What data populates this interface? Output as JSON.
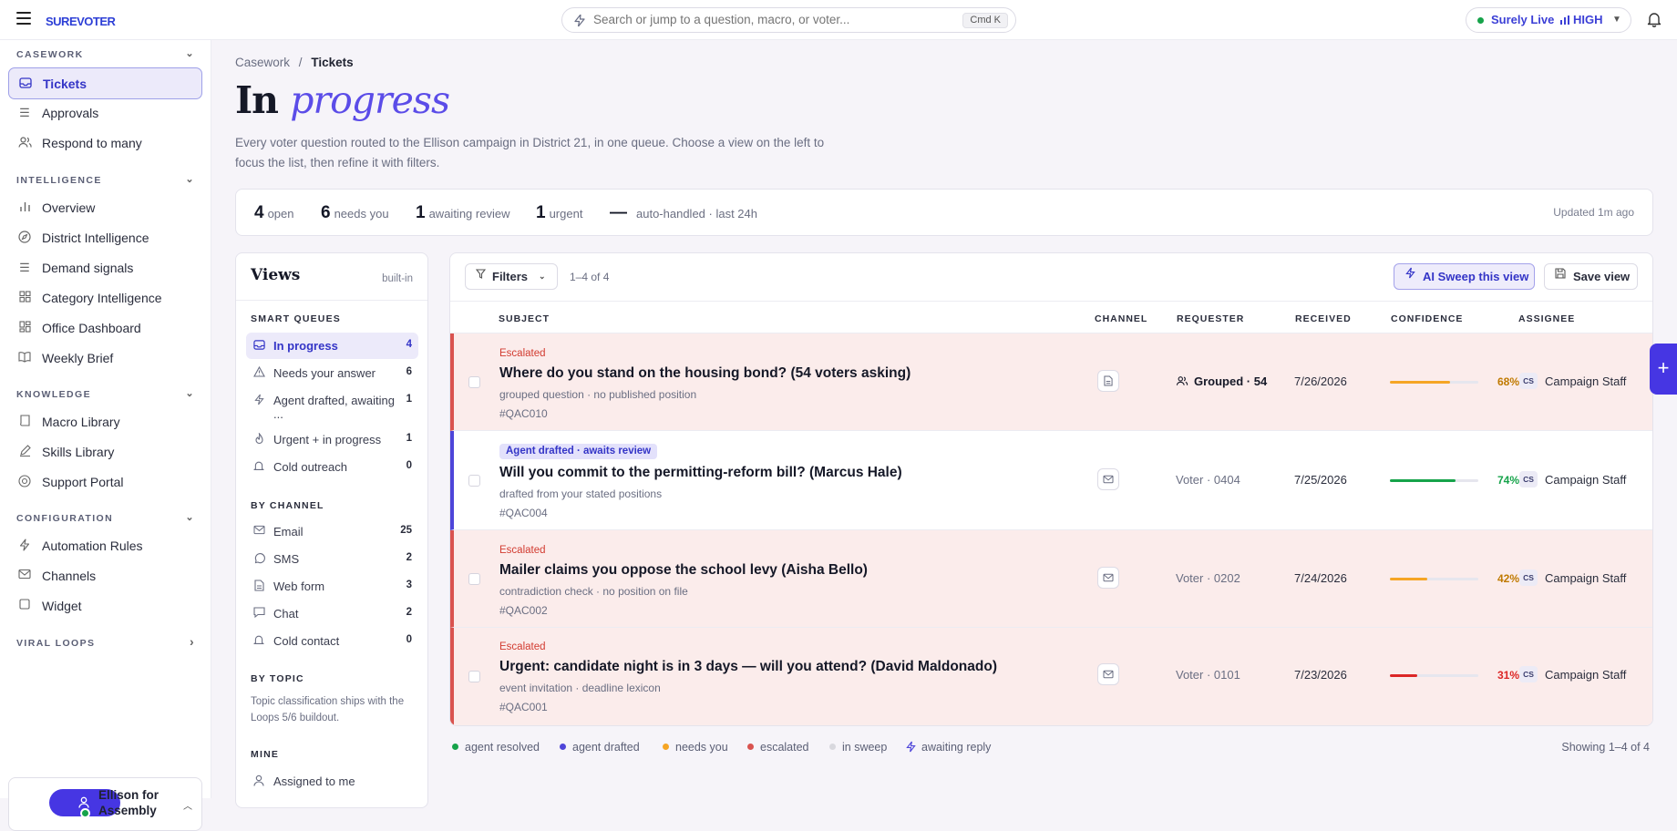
{
  "app": {
    "logo": "SUREVOTER",
    "search_placeholder": "Search or jump to a question, macro, or voter...",
    "search_shortcut": "Cmd K",
    "live_label": "Surely Live",
    "live_level": "HIGH"
  },
  "sidebar": {
    "sections": [
      {
        "title": "CASEWORK",
        "items": [
          "Tickets",
          "Approvals",
          "Respond to many"
        ]
      },
      {
        "title": "INTELLIGENCE",
        "items": [
          "Overview",
          "District Intelligence",
          "Demand signals",
          "Category Intelligence",
          "Office Dashboard",
          "Weekly Brief"
        ]
      },
      {
        "title": "KNOWLEDGE",
        "items": [
          "Macro Library",
          "Skills Library",
          "Support Portal"
        ]
      },
      {
        "title": "CONFIGURATION",
        "items": [
          "Automation Rules",
          "Channels",
          "Widget"
        ]
      },
      {
        "title": "VIRAL LOOPS",
        "items": []
      }
    ],
    "org_name": "Ellison for Assembly"
  },
  "breadcrumb": {
    "parent": "Casework",
    "current": "Tickets"
  },
  "page": {
    "title_plain": "In",
    "title_italic": "progress",
    "description": "Every voter question routed to the Ellison campaign in District 21, in one queue. Choose a view on the left to focus the list, then refine it with filters."
  },
  "stats": {
    "open": {
      "value": "4",
      "label": "open"
    },
    "needs_you": {
      "value": "6",
      "label": "needs you"
    },
    "awaiting": {
      "value": "1",
      "label": "awaiting review"
    },
    "urgent": {
      "value": "1",
      "label": "urgent"
    },
    "auto": {
      "value": "—",
      "label": "auto-handled · last 24h"
    },
    "updated": "Updated 1m ago"
  },
  "views": {
    "title": "Views",
    "badge": "built-in",
    "smart_heading": "SMART QUEUES",
    "smart": [
      {
        "label": "In progress",
        "count": "4"
      },
      {
        "label": "Needs your answer",
        "count": "6"
      },
      {
        "label": "Agent drafted, awaiting ...",
        "count": "1"
      },
      {
        "label": "Urgent + in progress",
        "count": "1"
      },
      {
        "label": "Cold outreach",
        "count": "0"
      }
    ],
    "channel_heading": "BY CHANNEL",
    "channels": [
      {
        "label": "Email",
        "count": "25"
      },
      {
        "label": "SMS",
        "count": "2"
      },
      {
        "label": "Web form",
        "count": "3"
      },
      {
        "label": "Chat",
        "count": "2"
      },
      {
        "label": "Cold contact",
        "count": "0"
      }
    ],
    "topic_heading": "BY TOPIC",
    "topic_note": "Topic classification ships with the Loops 5/6 buildout.",
    "mine_heading": "MINE",
    "mine": [
      {
        "label": "Assigned to me"
      }
    ]
  },
  "toolbar": {
    "filters_label": "Filters",
    "range": "1–4 of 4",
    "sweep_label": "AI Sweep this view",
    "save_label": "Save view"
  },
  "table": {
    "columns": [
      "SUBJECT",
      "CHANNEL",
      "REQUESTER",
      "RECEIVED",
      "CONFIDENCE",
      "ASSIGNEE"
    ],
    "rows": [
      {
        "status": "Escalated",
        "title": "Where do you stand on the housing bond? (54 voters asking)",
        "sub": "grouped question · no published position",
        "id": "#QAC010",
        "channel": "doc",
        "requester": "Grouped · 54",
        "received": "7/26/2026",
        "confidence": 68,
        "confidence_label": "68%",
        "confidence_color": "#f5a524",
        "assignee_initials": "CS",
        "assignee": "Campaign Staff"
      },
      {
        "status": "Agent drafted · awaits review",
        "title": "Will you commit to the permitting-reform bill? (Marcus Hale)",
        "sub": "drafted from your stated positions",
        "id": "#QAC004",
        "channel": "mail",
        "requester": "Voter · 0404",
        "received": "7/25/2026",
        "confidence": 74,
        "confidence_label": "74%",
        "confidence_color": "#16a34a",
        "assignee_initials": "CS",
        "assignee": "Campaign Staff"
      },
      {
        "status": "Escalated",
        "title": "Mailer claims you oppose the school levy (Aisha Bello)",
        "sub": "contradiction check · no position on file",
        "id": "#QAC002",
        "channel": "mail",
        "requester": "Voter · 0202",
        "received": "7/24/2026",
        "confidence": 42,
        "confidence_label": "42%",
        "confidence_color": "#f5a524",
        "assignee_initials": "CS",
        "assignee": "Campaign Staff"
      },
      {
        "status": "Escalated",
        "title": "Urgent: candidate night is in 3 days — will you attend? (David Maldonado)",
        "sub": "event invitation · deadline lexicon",
        "id": "#QAC001",
        "channel": "mail",
        "requester": "Voter · 0101",
        "received": "7/23/2026",
        "confidence": 31,
        "confidence_label": "31%",
        "confidence_color": "#dc2626",
        "assignee_initials": "CS",
        "assignee": "Campaign Staff"
      }
    ]
  },
  "legend": [
    {
      "label": "agent resolved",
      "color": "#16a34a"
    },
    {
      "label": "agent drafted",
      "color": "#4e45d9"
    },
    {
      "label": "needs you",
      "color": "#f5a524"
    },
    {
      "label": "escalated",
      "color": "#d9534f"
    },
    {
      "label": "in sweep",
      "color": "#d8d8de"
    },
    {
      "label": "awaiting reply",
      "color": "bolt"
    }
  ],
  "showing": "Showing 1–4 of 4"
}
